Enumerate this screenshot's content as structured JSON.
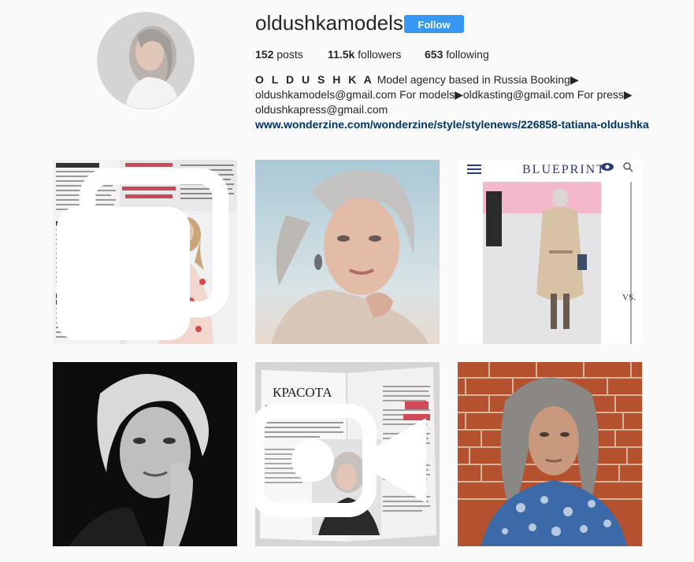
{
  "profile": {
    "username": "oldushkamodels",
    "follow_label": "Follow",
    "stats": {
      "posts_count": "152",
      "posts_label": "posts",
      "followers_count": "11.5k",
      "followers_label": "followers",
      "following_count": "653",
      "following_label": "following"
    },
    "bio": {
      "name": "O L D U S H K A",
      "text": "Model agency based in Russia Booking▶ oldushkamodels@gmail.com For models▶oldkasting@gmail.com For press▶ oldushkapress@gmail.com",
      "link": "www.wonderzine.com/wonderzine/style/stylenews/226858-tatiana-oldushka"
    }
  },
  "posts": [
    {
      "kind": "magazine-spread",
      "icon": "multiple-posts-icon",
      "headline": "НЕПАНИЕ ПОРОЖДАЕТ СТРАХ, ИЗ-ЗА НЕГО МЫ СТАНОВИМСЯ НЕКРАСИВЫМИ",
      "sections": [
        "Об изменениях",
        "О стиле",
        "О внешней красоте"
      ]
    },
    {
      "kind": "portrait-color",
      "icon": null
    },
    {
      "kind": "runway-blueprint",
      "icon": "eye-icon",
      "brand": "BLUEPRINT",
      "side_text": "VS."
    },
    {
      "kind": "portrait-bw",
      "icon": null
    },
    {
      "kind": "magazine-open",
      "icon": "video-icon",
      "headline": "КРАСОТА ВНЕ ВРЕМЕНИ"
    },
    {
      "kind": "portrait-brick",
      "icon": null
    }
  ],
  "colors": {
    "follow_button": "#3897f0",
    "link": "#003569",
    "background": "#fafafa"
  }
}
